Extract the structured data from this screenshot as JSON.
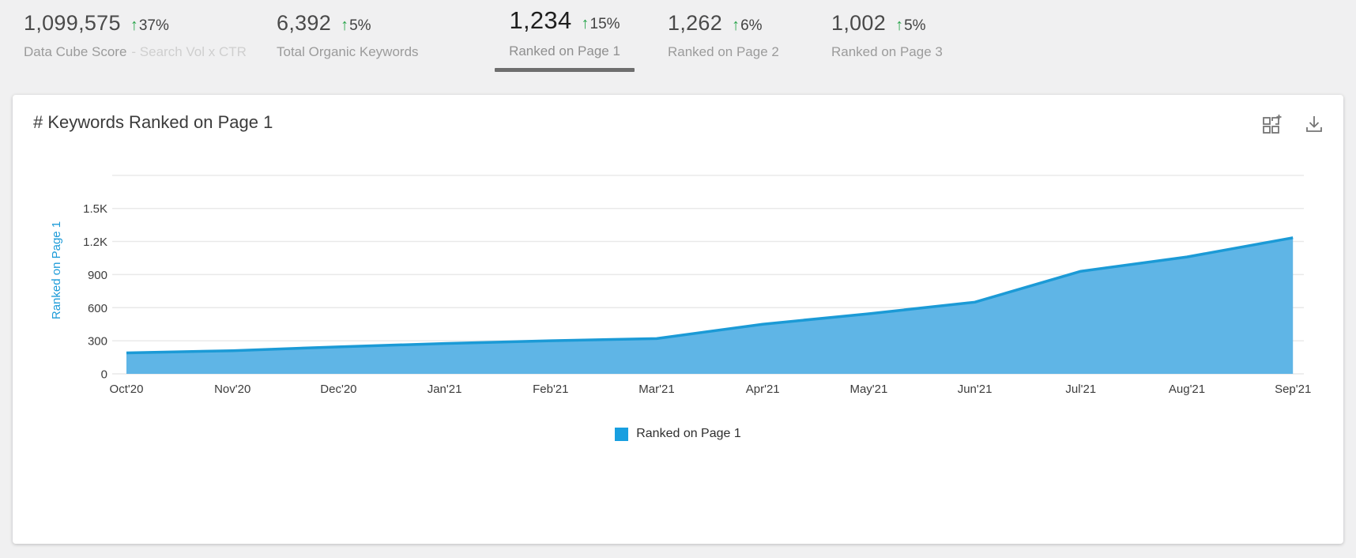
{
  "icons": {
    "up_arrow": "↑"
  },
  "stats": {
    "items": [
      {
        "value": "1,099,575",
        "delta": "37%",
        "label": "Data Cube Score",
        "sublabel": "- Search Vol x CTR",
        "active": false
      },
      {
        "value": "6,392",
        "delta": "5%",
        "label": "Total Organic Keywords",
        "active": false
      },
      {
        "value": "1,234",
        "delta": "15%",
        "label": "Ranked on Page 1",
        "active": true
      },
      {
        "value": "1,262",
        "delta": "6%",
        "label": "Ranked on Page 2",
        "active": false
      },
      {
        "value": "1,002",
        "delta": "5%",
        "label": "Ranked on Page 3",
        "active": false
      }
    ]
  },
  "card": {
    "title": "# Keywords Ranked on Page 1",
    "action_icons": [
      "add-to-dashboard-icon",
      "download-icon"
    ]
  },
  "chart_data": {
    "type": "area",
    "title": "# Keywords Ranked on Page 1",
    "categories": [
      "Oct'20",
      "Nov'20",
      "Dec'20",
      "Jan'21",
      "Feb'21",
      "Mar'21",
      "Apr'21",
      "May'21",
      "Jun'21",
      "Jul'21",
      "Aug'21",
      "Sep'21"
    ],
    "series": [
      {
        "name": "Ranked on Page 1",
        "values": [
          190,
          210,
          245,
          275,
          300,
          320,
          450,
          545,
          650,
          930,
          1060,
          1234
        ]
      }
    ],
    "xlabel": "",
    "ylabel": "Ranked on Page 1",
    "ylim": [
      0,
      1800
    ],
    "yticks": [
      {
        "value": 0,
        "label": "0"
      },
      {
        "value": 300,
        "label": "300"
      },
      {
        "value": 600,
        "label": "600"
      },
      {
        "value": 900,
        "label": "900"
      },
      {
        "value": 1200,
        "label": "1.2K"
      },
      {
        "value": 1500,
        "label": "1.5K"
      },
      {
        "value": 1800,
        "label": ""
      }
    ],
    "grid": true,
    "legend_position": "bottom",
    "area_fill": "#5fb5e6",
    "line_color": "#1b9ad6",
    "grid_color": "#e9e9e9"
  },
  "legend": {
    "items": [
      {
        "label": "Ranked on Page 1",
        "color": "#189fe0"
      }
    ]
  },
  "colors": {
    "page_bg": "#f0f0f1",
    "card_bg": "#ffffff",
    "positive_green": "#27a44a",
    "accent_blue": "#1b9ad6",
    "area_fill": "#5fb5e6",
    "active_underline": "#6e6e6e"
  }
}
